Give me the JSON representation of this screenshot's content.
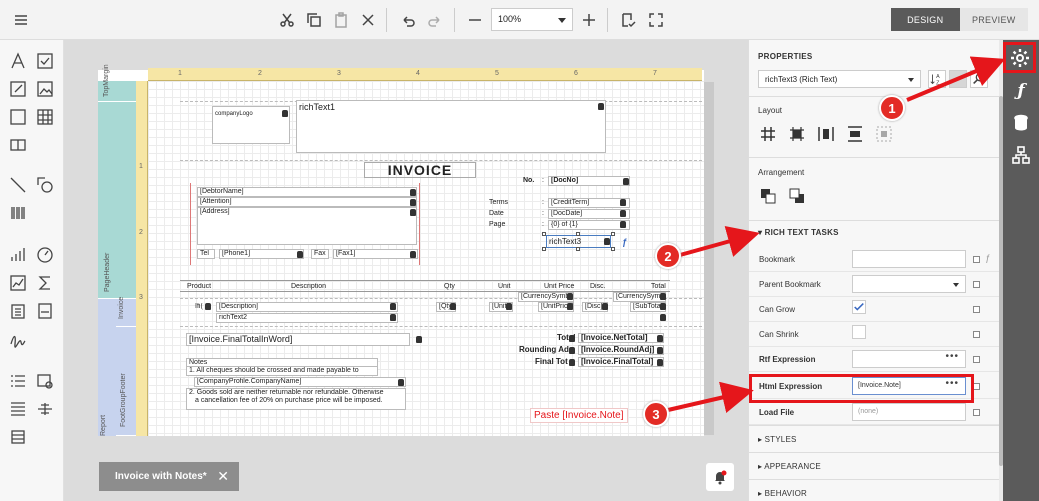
{
  "toolbar": {
    "zoom_value": "100%",
    "design_label": "DESIGN",
    "preview_label": "PREVIEW"
  },
  "report": {
    "bands": [
      "TopMargin",
      "PageHeader",
      "Invoice",
      "FootGroupFooter",
      "Report"
    ],
    "company_logo": "companyLogo",
    "rich_text1": "richText1",
    "title": "INVOICE",
    "debtor_name": "[DebtorName]",
    "attention": "[Attention]",
    "address": "[Address]",
    "tel_label": "Tel",
    "phone1": "[Phone1]",
    "fax_label": "Fax",
    "fax1": "[Fax1]",
    "no_label": "No.",
    "colon": ":",
    "doc_no": "[DocNo]",
    "terms_label": "Terms",
    "credit_term": "[CreditTerm]",
    "date_label": "Date",
    "doc_date": "[DocDate]",
    "page_label": "Page",
    "page_value": "{0} of {1}",
    "rich_text3": "richText3",
    "columns": [
      "Product",
      "Description",
      "Qty",
      "Unit",
      "Unit Price",
      "Disc.",
      "Total"
    ],
    "currency_symbol": "[CurrencySymbol]",
    "row_item": "Ifi(",
    "description": "[Description]",
    "qty": "[Qty]",
    "unit": "[Unit]",
    "unit_price": "[UnitPrice]",
    "disc": "[Disc]",
    "sub_total": "[SubTotal]",
    "rich_text2": "richText2",
    "final_total_word": "[Invoice.FinalTotalInWord]",
    "total_label": "Total",
    "net_total": "[Invoice.NetTotal]",
    "rounding_label": "Rounding Ad",
    "round_adj": "[Invoice.RoundAdj]",
    "final_total_label": "Final Tot",
    "final_total": "[Invoice.FinalTotal]",
    "notes_label": "Notes",
    "note1": "1. All cheques should be crossed and made payable to",
    "company_name": "[CompanyProfile.CompanyName]",
    "note2a": "2. Goods sold are neither returnable nor refundable. Otherwise",
    "note2b": "a cancellation fee of 20% on purchase price will be imposed.",
    "ruler_marks": [
      "1",
      "2",
      "3",
      "4",
      "5",
      "6",
      "7"
    ]
  },
  "tab": {
    "label": "Invoice with Notes*",
    "close": "✕"
  },
  "properties": {
    "header": "PROPERTIES",
    "selected": "richText3 (Rich Text)",
    "layout_label": "Layout",
    "arrangement_label": "Arrangement",
    "tasks_label": "RICH TEXT TASKS",
    "rows": [
      {
        "label": "Bookmark",
        "value": ""
      },
      {
        "label": "Parent Bookmark",
        "value": ""
      },
      {
        "label": "Can Grow",
        "value": "checked"
      },
      {
        "label": "Can Shrink",
        "value": ""
      },
      {
        "label": "Rtf Expression",
        "value": ""
      },
      {
        "label": "Html Expression",
        "value": "[Invoice.Note]"
      },
      {
        "label": "Load File",
        "value": "(none)"
      }
    ],
    "groups": [
      "STYLES",
      "APPEARANCE",
      "BEHAVIOR"
    ],
    "dots": "•••"
  },
  "callouts": {
    "one": "1",
    "two": "2",
    "three": "3",
    "paste_note": "Paste [Invoice.Note]"
  },
  "colors": {
    "accent_red": "#e5161b",
    "panel_dark": "#5b5b5b",
    "ruler": "#f6e6a5"
  }
}
